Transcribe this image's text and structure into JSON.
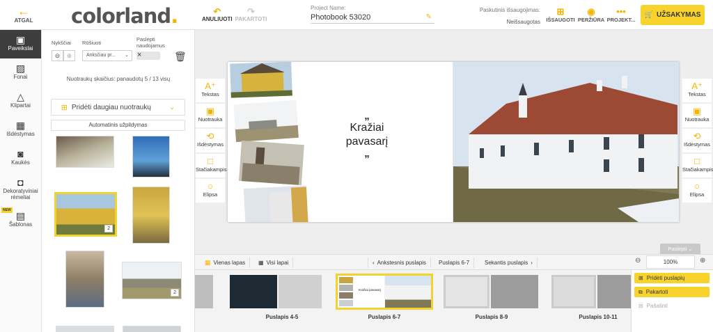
{
  "header": {
    "back_label": "ATGAL",
    "logo_main": "colorland",
    "logo_dot": ".",
    "undo_label": "ANULIUOTI",
    "redo_label": "PAKARTOTI",
    "project_label": "Project Name:",
    "project_name": "Photobook 53020",
    "last_saved_label": "Paskutinis išsaugojimas:",
    "last_saved_value": "Neišsaugotas",
    "save_label": "IŠSAUGOTI",
    "preview_label": "PERŽIŪRA",
    "project_menu_label": "PROJEKT...",
    "order_label": "UŽSAKYMAS"
  },
  "sidebar": {
    "items": [
      {
        "label": "Paveikslai",
        "icon": "image-icon",
        "active": true
      },
      {
        "label": "Fonai",
        "icon": "pattern-icon"
      },
      {
        "label": "Klipartai",
        "icon": "shapes-icon"
      },
      {
        "label": "Išdėstymas",
        "icon": "layout-icon"
      },
      {
        "label": "Kaukės",
        "icon": "mask-icon"
      },
      {
        "label": "Dekoratyviniai rėmeliai",
        "icon": "frame-icon"
      },
      {
        "label": "Šablonas",
        "icon": "template-icon",
        "badge": "NEW"
      }
    ]
  },
  "photos_panel": {
    "thumbnails_label": "Nykščiai",
    "sort_label": "Rūšiuoti",
    "sort_value": "Anksčiau pr...",
    "hide_used_label": "Paslėpti naudojamus",
    "count_text": "Nuotraukų skaičius: panaudotų 5 / 13 visų",
    "add_more_label": "Pridėti daugiau nuotraukų",
    "autofill_label": "Automatinis užpildymas",
    "badges": [
      "2",
      "2"
    ]
  },
  "tools": {
    "left": [
      {
        "label": "Tekstas",
        "icon": "text-add-icon"
      },
      {
        "label": "Nuotrauka",
        "icon": "photo-add-icon"
      },
      {
        "label": "Išdėstymas",
        "icon": "rotate-layout-icon"
      },
      {
        "label": "Stačiakampis",
        "icon": "rectangle-icon"
      },
      {
        "label": "Elipsa",
        "icon": "ellipse-icon"
      }
    ],
    "right": [
      {
        "label": "Tekstas",
        "icon": "text-add-icon"
      },
      {
        "label": "Nuotrauka",
        "icon": "photo-add-icon"
      },
      {
        "label": "Išdėstymas",
        "icon": "rotate-layout-icon"
      },
      {
        "label": "Stačiakampis",
        "icon": "rectangle-icon"
      },
      {
        "label": "Elipsa",
        "icon": "ellipse-icon"
      }
    ]
  },
  "spread": {
    "quote_open": "„",
    "quote_line1": "Kražiai",
    "quote_line2": "pavasarį",
    "quote_close": "„"
  },
  "pagebar": {
    "single_page": "Vienas lapas",
    "all_pages": "Visi lapai",
    "prev_page": "Ankstesnis puslapis",
    "current_page": "Puslapis 6-7",
    "next_page": "Sekantis puslapis",
    "zoom": "100%",
    "hide_label": "Paslėpti"
  },
  "filmstrip": {
    "pages": [
      {
        "label": "Puslapis 4-5"
      },
      {
        "label": "Puslapis 6-7",
        "selected": true
      },
      {
        "label": "Puslapis 8-9"
      },
      {
        "label": "Puslapis 10-11"
      }
    ],
    "mini_quote": "Kražiai pavasarį"
  },
  "page_menu": {
    "add_page": "Pridėti puslapių",
    "repeat": "Pakartoti",
    "delete": "Pašalinti"
  }
}
